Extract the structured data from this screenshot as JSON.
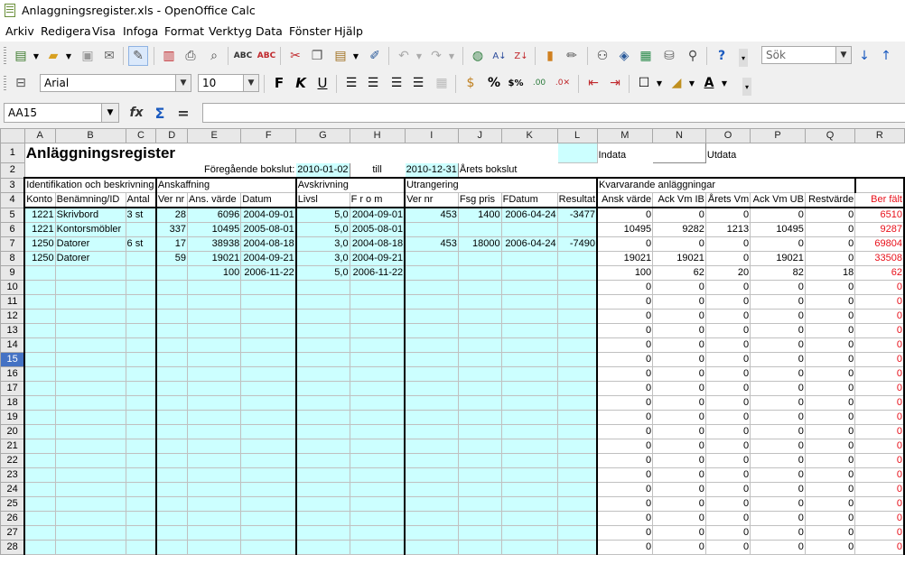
{
  "window": {
    "title": "Anlaggningsregister.xls - OpenOffice Calc"
  },
  "menu": [
    "Arkiv",
    "Redigera",
    "Visa",
    "Infoga",
    "Format",
    "Verktyg",
    "Data",
    "Fönster",
    "Hjälp"
  ],
  "toolbar": {
    "search_placeholder": "Sök",
    "font_name": "Arial",
    "font_size": "10",
    "bold": "F",
    "italic": "K",
    "underline": "U",
    "percent": "%"
  },
  "formula_bar": {
    "cell_ref": "AA15",
    "formula": ""
  },
  "columns": [
    "A",
    "B",
    "C",
    "D",
    "E",
    "F",
    "G",
    "H",
    "I",
    "J",
    "K",
    "L",
    "M",
    "N",
    "O",
    "P",
    "Q",
    "R"
  ],
  "sheet": {
    "title": "Anläggningsregister",
    "legend_indata": "Indata",
    "legend_utdata": "Utdata",
    "prev_close_label": "Föregående bokslut:",
    "prev_close_value": "2010-01-02",
    "till_label": "till",
    "year_close_value": "2010-12-31",
    "year_close_label": "Årets bokslut",
    "group_identification": "Identifikation och beskrivning",
    "group_acquisition": "Anskaffning",
    "group_depreciation": "Avskrivning",
    "group_disposal": "Utrangering",
    "group_remaining": "Kvarvarande anläggningar",
    "headers": [
      "Konto",
      "Benämning/ID",
      "Antal",
      "Ver nr",
      "Ans. värde",
      "Datum",
      "Livsl",
      "F r o m",
      "Ver nr",
      "Fsg pris",
      "FDatum",
      "Resultat",
      "Ansk värde",
      "Ack Vm IB",
      "Årets Vm",
      "Ack Vm UB",
      "Restvärde",
      "Ber fält"
    ],
    "data_rows": [
      [
        "1221",
        "Skrivbord",
        "3 st",
        "28",
        "6096",
        "2004-09-01",
        "5,0",
        "2004-09-01",
        "453",
        "1400",
        "2006-04-24",
        "-3477",
        "0",
        "0",
        "0",
        "0",
        "0",
        "6510"
      ],
      [
        "1221",
        "Kontorsmöbler",
        "",
        "337",
        "10495",
        "2005-08-01",
        "5,0",
        "2005-08-01",
        "",
        "",
        "",
        "",
        "10495",
        "9282",
        "1213",
        "10495",
        "0",
        "9287"
      ],
      [
        "1250",
        "Datorer",
        "6 st",
        "17",
        "38938",
        "2004-08-18",
        "3,0",
        "2004-08-18",
        "453",
        "18000",
        "2006-04-24",
        "-7490",
        "0",
        "0",
        "0",
        "0",
        "0",
        "69804"
      ],
      [
        "1250",
        "Datorer",
        "",
        "59",
        "19021",
        "2004-09-21",
        "3,0",
        "2004-09-21",
        "",
        "",
        "",
        "",
        "19021",
        "19021",
        "0",
        "19021",
        "0",
        "33508"
      ],
      [
        "",
        "",
        "",
        "",
        "100",
        "2006-11-22",
        "5,0",
        "2006-11-22",
        "",
        "",
        "",
        "",
        "100",
        "62",
        "20",
        "82",
        "18",
        "62"
      ]
    ],
    "empty_row_values": [
      "0",
      "0",
      "0",
      "0",
      "0",
      "0"
    ],
    "selected_row": "15",
    "row_count": 28
  }
}
